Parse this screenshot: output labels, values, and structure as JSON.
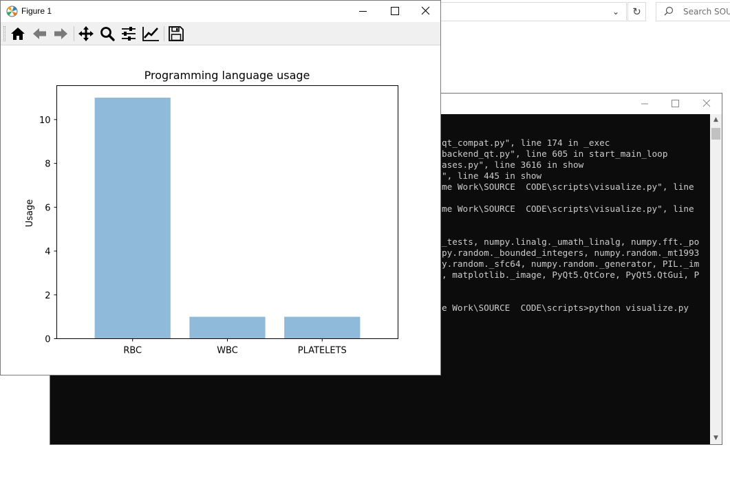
{
  "figure_window": {
    "title": "Figure 1",
    "toolbar": {
      "home": "home-icon",
      "back": "arrow-left-icon",
      "forward": "arrow-right-icon",
      "pan": "move-icon",
      "zoom": "magnifier-icon",
      "configure": "sliders-icon",
      "edit": "chart-line-icon",
      "save": "floppy-disk-icon"
    }
  },
  "explorer": {
    "search_placeholder": "Search SOUR"
  },
  "console": {
    "lines": [
      "qt_compat.py\", line 174 in _exec",
      "backend_qt.py\", line 605 in start_main_loop",
      "ases.py\", line 3616 in show",
      "\", line 445 in show",
      "me Work\\SOURCE  CODE\\scripts\\visualize.py\", line",
      "",
      "me Work\\SOURCE  CODE\\scripts\\visualize.py\", line",
      "",
      "",
      "_tests, numpy.linalg._umath_linalg, numpy.fft._po",
      "py.random._bounded_integers, numpy.random._mt1993",
      "y.random._sfc64, numpy.random._generator, PIL._im",
      ", matplotlib._image, PyQt5.QtCore, PyQt5.QtGui, P",
      "",
      "",
      "e Work\\SOURCE  CODE\\scripts>python visualize.py"
    ]
  },
  "chart_data": {
    "type": "bar",
    "title": "Programming language usage",
    "xlabel": "",
    "ylabel": "Usage",
    "categories": [
      "RBC",
      "WBC",
      "PLATELETS"
    ],
    "values": [
      11,
      1,
      1
    ],
    "ylim": [
      0,
      11.55
    ],
    "yticks": [
      0,
      2,
      4,
      6,
      8,
      10
    ],
    "bar_color": "#8fbad9",
    "grid": false,
    "legend": false
  }
}
